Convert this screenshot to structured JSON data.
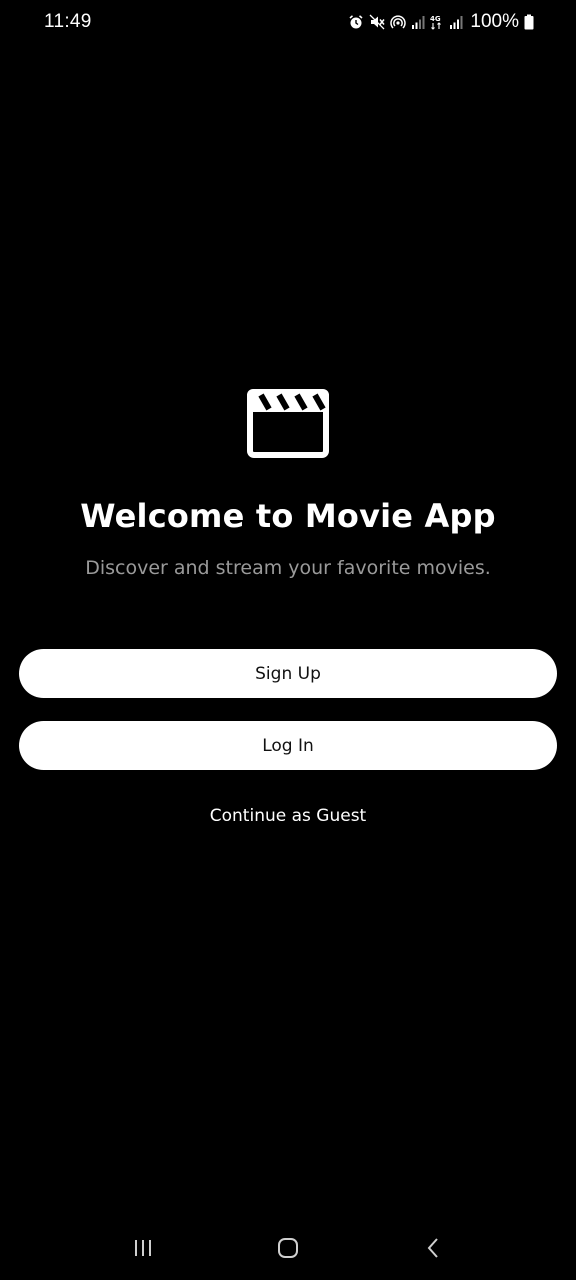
{
  "status_bar": {
    "time": "11:49",
    "battery_percent": "100%",
    "icons": [
      "alarm-icon",
      "mute-icon",
      "hotspot-icon",
      "signal-icon",
      "4g-icon",
      "signal-icon",
      "battery-icon"
    ]
  },
  "welcome": {
    "logo_icon": "clapperboard-icon",
    "title": "Welcome to Movie App",
    "subtitle": "Discover and stream your favorite movies."
  },
  "actions": {
    "signup_label": "Sign Up",
    "login_label": "Log In",
    "guest_label": "Continue as Guest"
  },
  "nav_bar": {
    "icons": [
      "recent-apps-icon",
      "home-icon",
      "back-icon"
    ]
  },
  "colors": {
    "background": "#000000",
    "text_primary": "#ffffff",
    "text_secondary": "#9a9a9a",
    "button_bg": "#ffffff",
    "button_text": "#111111"
  }
}
